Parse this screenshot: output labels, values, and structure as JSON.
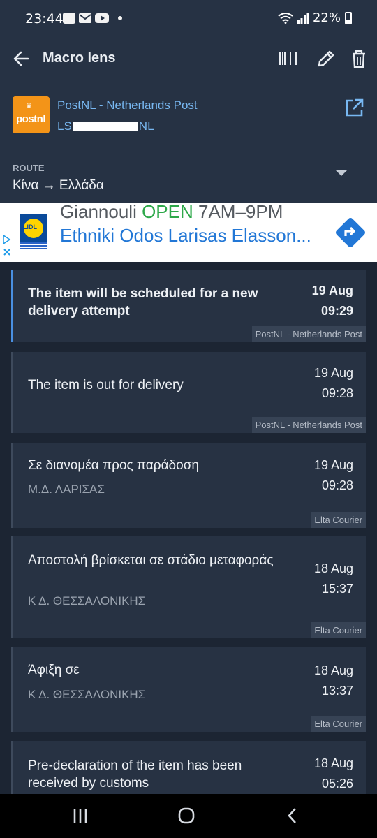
{
  "status_bar": {
    "time": "23:44",
    "battery": "22%"
  },
  "app_bar": {
    "title": "Macro lens"
  },
  "shipment": {
    "courier": "PostNL - Netherlands Post",
    "tracking_prefix": "LS",
    "tracking_suffix": "NL",
    "logo_text": "postnl",
    "route_label": "ROUTE",
    "route": "Κίνα → Ελλάδα"
  },
  "ad": {
    "line1_name": "Giannouli ",
    "line1_status": "OPEN",
    "line1_hours": " 7AM–9PM",
    "line2": "Ethniki Odos Larisas Elasson...",
    "logo_text": "LIDL"
  },
  "events": [
    {
      "title": "The item will be scheduled for a new delivery attempt",
      "location": "",
      "date": "19 Aug",
      "time": "09:29",
      "source": "PostNL - Netherlands Post"
    },
    {
      "title": "The item is out for delivery",
      "location": "",
      "date": "19 Aug",
      "time": "09:28",
      "source": "PostNL - Netherlands Post"
    },
    {
      "title": "Σε διανομέα προς παράδοση",
      "location": "Μ.Δ. ΛΑΡΙΣΑΣ",
      "date": "19 Aug",
      "time": "09:28",
      "source": "Elta Courier"
    },
    {
      "title": "Αποστολή βρίσκεται σε στάδιο μεταφοράς",
      "location": "Κ Δ. ΘΕΣΣΑΛΟΝΙΚΗΣ",
      "date": "18 Aug",
      "time": "15:37",
      "source": "Elta Courier"
    },
    {
      "title": "Άφιξη σε",
      "location": "Κ Δ. ΘΕΣΣΑΛΟΝΙΚΗΣ",
      "date": "18 Aug",
      "time": "13:37",
      "source": "Elta Courier"
    },
    {
      "title": "Pre-declaration of the  item has been received by customs",
      "location": "",
      "date": "18 Aug",
      "time": "05:26",
      "source": ""
    }
  ],
  "colors": {
    "accent": "#4a90e2",
    "link": "#78b8f2",
    "background": "#1c2533",
    "card": "#273243"
  }
}
